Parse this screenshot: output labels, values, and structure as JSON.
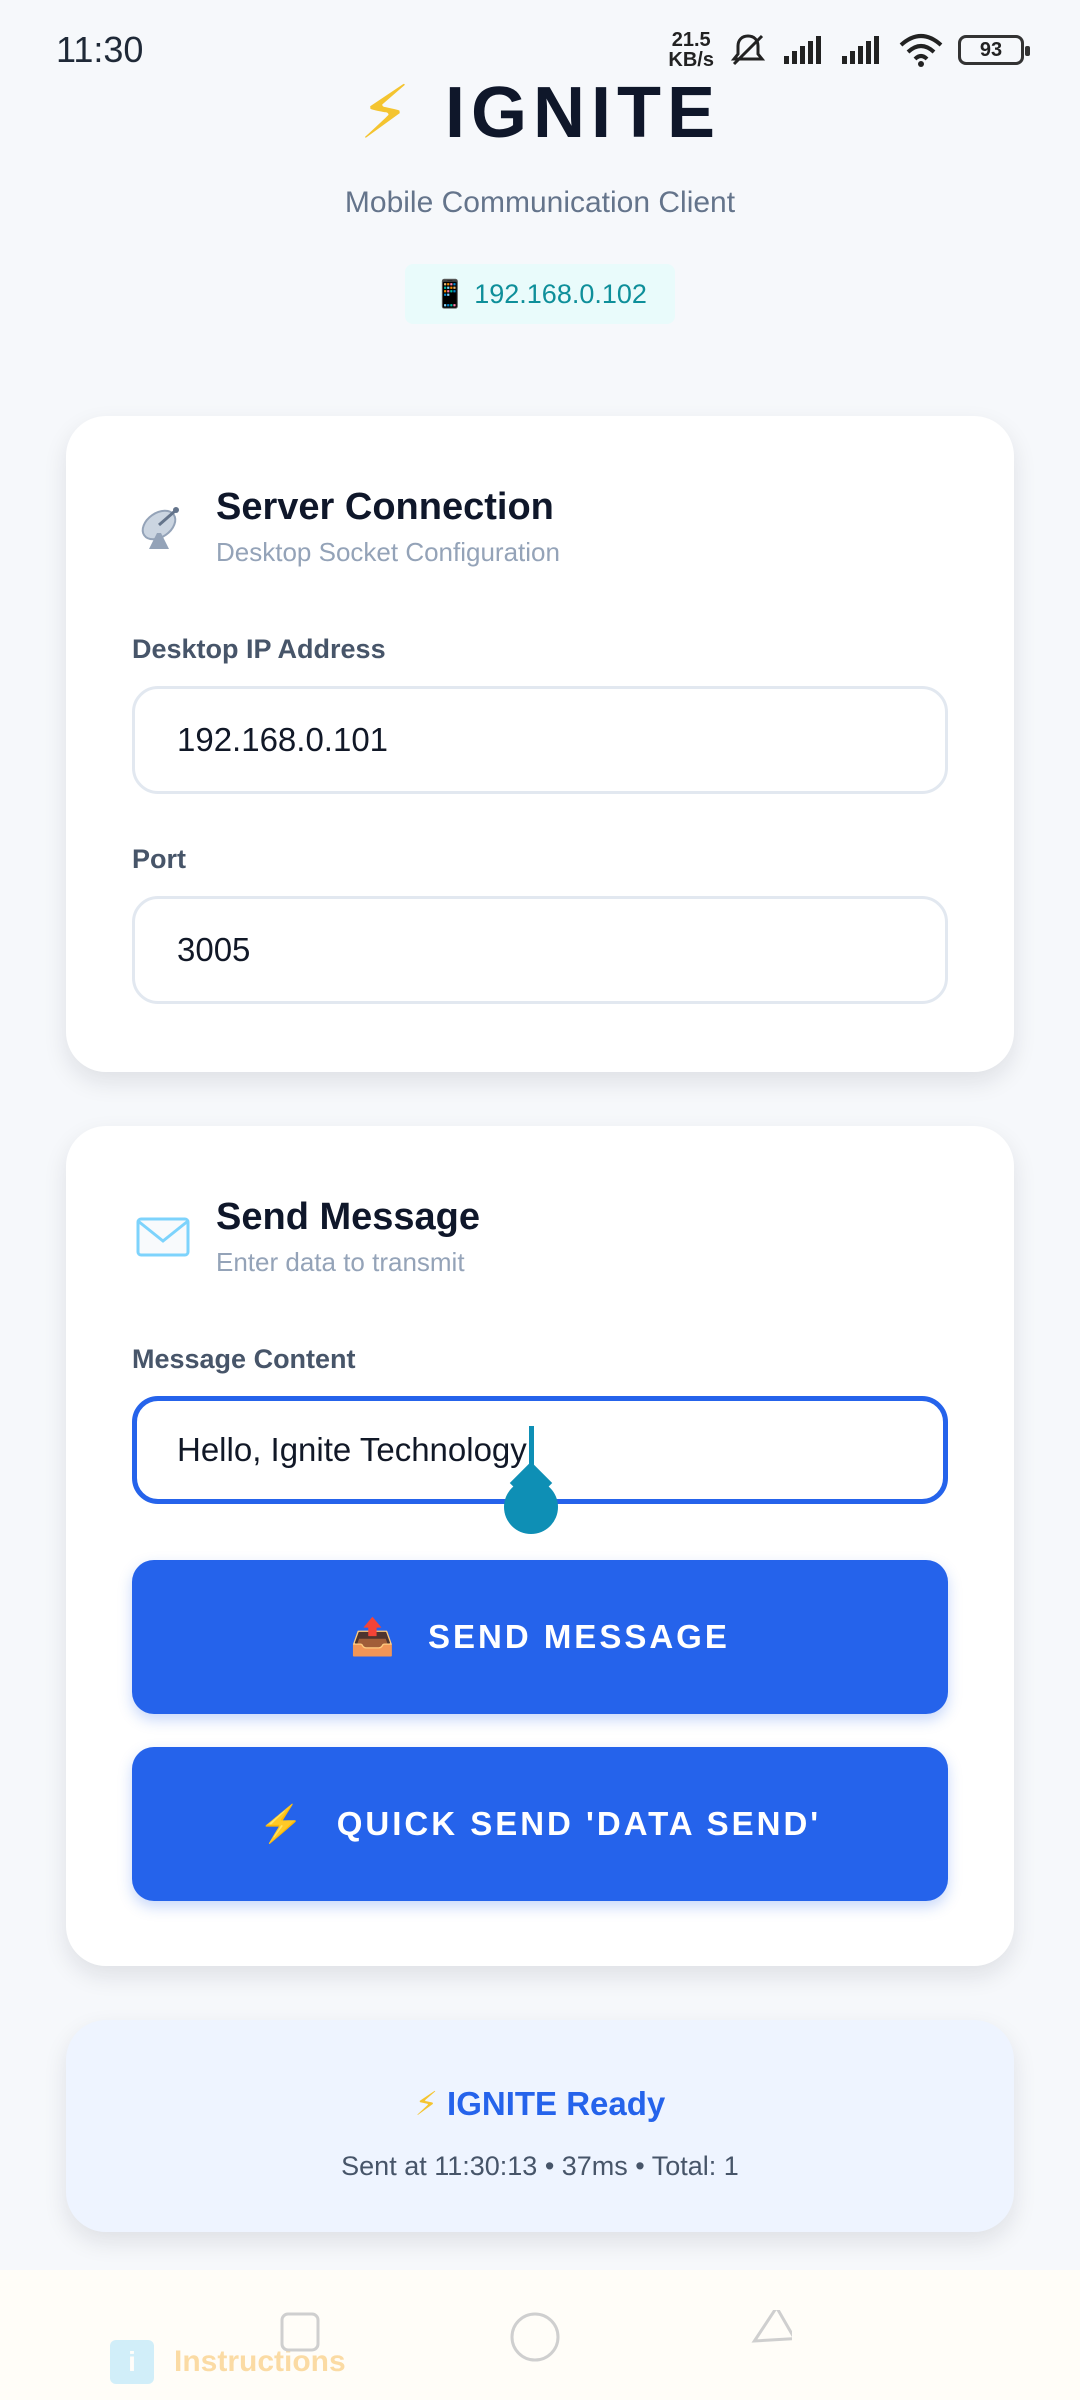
{
  "status_bar": {
    "time": "11:30",
    "net_speed_value": "21.5",
    "net_speed_unit": "KB/s",
    "battery": "93",
    "icons": [
      "mute-icon",
      "signal-icon",
      "signal-icon",
      "wifi-icon",
      "battery-icon"
    ]
  },
  "header": {
    "title": "IGNITE",
    "title_icon": "bolt-icon",
    "subtitle": "Mobile Communication Client",
    "device_ip": "192.168.0.102",
    "device_icon": "phone-icon"
  },
  "server_card": {
    "title": "Server Connection",
    "subtitle": "Desktop Socket Configuration",
    "icon": "satellite-dish-icon",
    "ip_label": "Desktop IP Address",
    "ip_value": "192.168.0.101",
    "port_label": "Port",
    "port_value": "3005"
  },
  "message_card": {
    "title": "Send Message",
    "subtitle": "Enter data to transmit",
    "icon": "envelope-icon",
    "content_label": "Message Content",
    "content_value": "Hello, Ignite Technology",
    "send_button": "SEND MESSAGE",
    "send_button_icon": "outbox-tray-icon",
    "quick_send_button": "QUICK SEND 'DATA SEND'",
    "quick_send_icon": "bolt-icon"
  },
  "status_card": {
    "title": "IGNITE Ready",
    "detail": "Sent at 11:30:13 • 37ms • Total: 1"
  },
  "bottom": {
    "instructions_label": "Instructions",
    "nav_icons": [
      "recents-icon",
      "home-icon",
      "back-icon"
    ]
  },
  "colors": {
    "primary": "#2563eb",
    "accent_bolt": "#f4c430",
    "ip_chip_text": "#0e8f9a",
    "background": "#f6f8fb"
  }
}
